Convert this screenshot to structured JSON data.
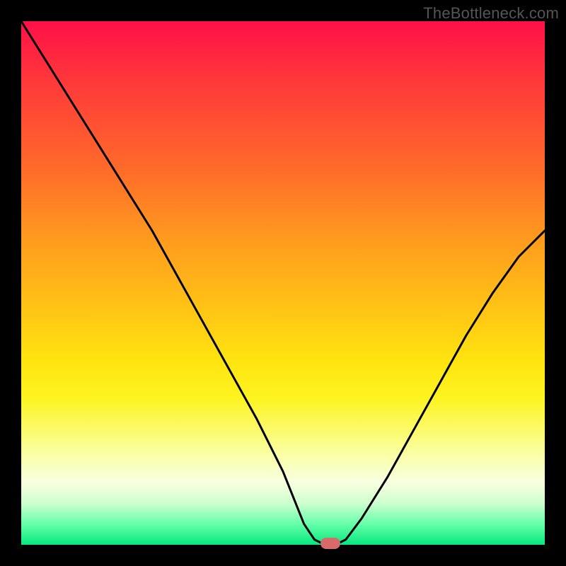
{
  "watermark": "TheBottleneck.com",
  "chart_data": {
    "type": "line",
    "title": "",
    "xlabel": "",
    "ylabel": "",
    "xlim": [
      0,
      100
    ],
    "ylim": [
      0,
      100
    ],
    "series": [
      {
        "name": "bottleneck-curve",
        "x": [
          0,
          5,
          10,
          15,
          20,
          25,
          30,
          35,
          40,
          45,
          50,
          54,
          56,
          58,
          60,
          62,
          65,
          70,
          75,
          80,
          85,
          90,
          95,
          100
        ],
        "y": [
          100,
          92,
          84,
          76,
          68,
          60,
          51,
          42,
          33,
          24,
          14,
          4,
          1,
          0,
          0,
          1,
          5,
          13,
          22,
          31,
          40,
          48,
          55,
          60
        ]
      }
    ],
    "marker": {
      "x": 59,
      "y": 0
    },
    "gradient_colors": {
      "top": "#ff1048",
      "mid": "#ffe40f",
      "bottom": "#06e77e"
    }
  }
}
